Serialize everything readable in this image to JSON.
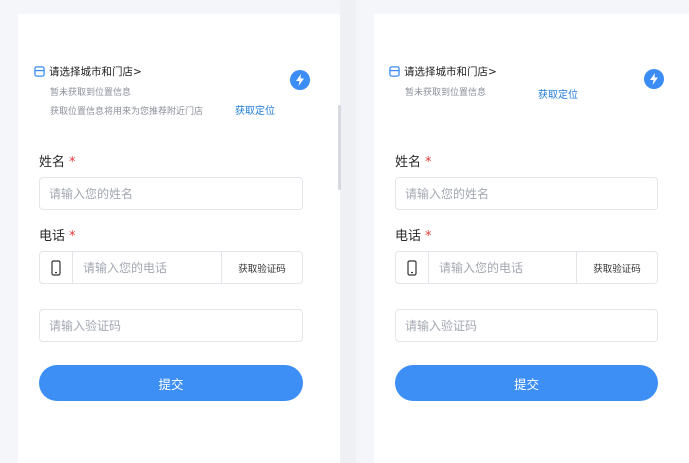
{
  "forms": [
    {
      "store_select": "请选择城市和门店>",
      "location_status": "暂未获取到位置信息",
      "location_hint": "获取位置信息将用来为您推荐附近门店",
      "get_location": "获取定位",
      "name_label": "姓名",
      "required_mark": "*",
      "name_placeholder": "请输入您的姓名",
      "phone_label": "电话",
      "phone_placeholder": "请输入您的电话",
      "get_code": "获取验证码",
      "code_placeholder": "请输入验证码",
      "submit": "提交"
    },
    {
      "store_select": "请选择城市和门店>",
      "location_status": "暂未获取到位置信息",
      "get_location": "获取定位",
      "name_label": "姓名",
      "required_mark": "*",
      "name_placeholder": "请输入您的姓名",
      "phone_label": "电话",
      "phone_placeholder": "请输入您的电话",
      "get_code": "获取验证码",
      "code_placeholder": "请输入验证码",
      "submit": "提交"
    }
  ],
  "colors": {
    "accent": "#3d8ff5",
    "link": "#1f7bd9",
    "required": "#e23b3b"
  },
  "icons": [
    "store-icon",
    "lightning-icon",
    "mobile-phone-icon"
  ]
}
